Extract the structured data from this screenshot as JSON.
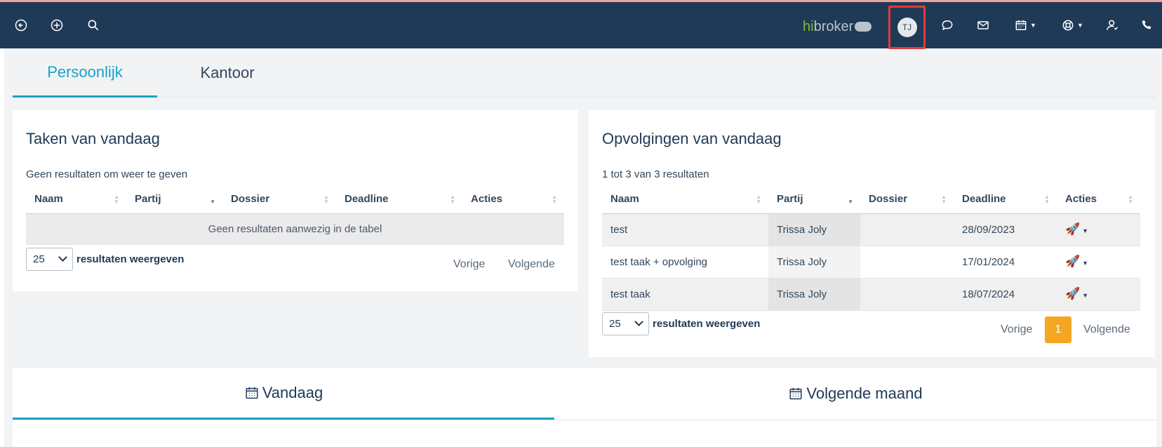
{
  "topbar": {
    "brand_hi": "hi",
    "brand_rest": "broker",
    "avatar_initials": "TJ",
    "accent": "#1f3a56"
  },
  "tabs": [
    {
      "label": "Persoonlijk",
      "active": true
    },
    {
      "label": "Kantoor",
      "active": false
    }
  ],
  "tasks": {
    "title": "Taken van vandaag",
    "info": "Geen resultaten om weer te geven",
    "columns": [
      "Naam",
      "Partij",
      "Dossier",
      "Deadline",
      "Acties"
    ],
    "empty": "Geen resultaten aanwezig in de tabel",
    "length_value": "25",
    "length_label": "resultaten weergeven",
    "prev": "Vorige",
    "next": "Volgende"
  },
  "followups": {
    "title": "Opvolgingen van vandaag",
    "info": "1 tot 3 van 3 resultaten",
    "columns": [
      "Naam",
      "Partij",
      "Dossier",
      "Deadline",
      "Acties"
    ],
    "rows": [
      {
        "naam": "test",
        "partij": "Trissa Joly",
        "dossier": "",
        "deadline": "28/09/2023"
      },
      {
        "naam": "test taak + opvolging",
        "partij": "Trissa Joly",
        "dossier": "",
        "deadline": "17/01/2024"
      },
      {
        "naam": "test taak",
        "partij": "Trissa Joly",
        "dossier": "",
        "deadline": "18/07/2024"
      }
    ],
    "length_value": "25",
    "length_label": "resultaten weergeven",
    "prev": "Vorige",
    "page": "1",
    "next": "Volgende"
  },
  "calendar_tabs": [
    {
      "label": "Vandaag",
      "active": true
    },
    {
      "label": "Volgende maand",
      "active": false
    }
  ],
  "colors": {
    "topbar": "#1f3a56",
    "tab_active": "#1aa3c8",
    "page_active": "#f5a623",
    "highlight_box": "#e23b3b"
  }
}
